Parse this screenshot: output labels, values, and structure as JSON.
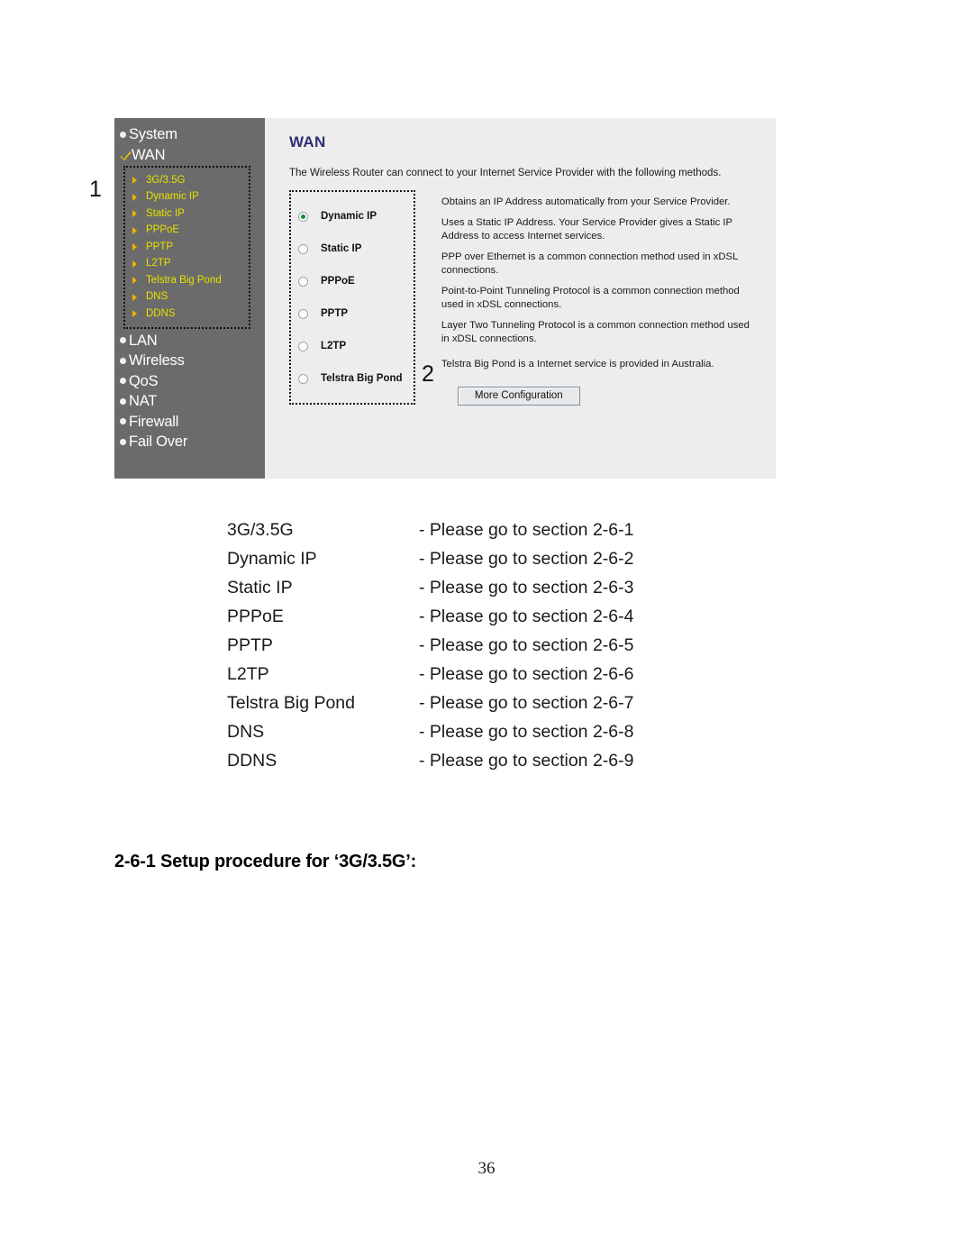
{
  "screenshot": {
    "sidebar": {
      "top_items": [
        {
          "label": "System",
          "icon": "bullet-icon",
          "selected": false
        },
        {
          "label": "WAN",
          "icon": "check-icon",
          "selected": true
        }
      ],
      "submenu": [
        {
          "label": "3G/3.5G"
        },
        {
          "label": "Dynamic IP"
        },
        {
          "label": "Static IP"
        },
        {
          "label": "PPPoE"
        },
        {
          "label": "PPTP"
        },
        {
          "label": "L2TP"
        },
        {
          "label": "Telstra Big Pond"
        },
        {
          "label": "DNS"
        },
        {
          "label": "DDNS"
        }
      ],
      "bottom_items": [
        {
          "label": "LAN"
        },
        {
          "label": "Wireless"
        },
        {
          "label": "QoS"
        },
        {
          "label": "NAT"
        },
        {
          "label": "Firewall"
        },
        {
          "label": "Fail Over"
        }
      ]
    },
    "main": {
      "title": "WAN",
      "intro": "The Wireless Router can connect to your Internet Service Provider with the following methods.",
      "methods": [
        {
          "label": "Dynamic IP",
          "selected": true,
          "description": "Obtains an IP Address automatically from your Service Provider."
        },
        {
          "label": "Static IP",
          "selected": false,
          "description": "Uses a Static IP Address. Your Service Provider gives a Static IP Address to access Internet services."
        },
        {
          "label": "PPPoE",
          "selected": false,
          "description": "PPP over Ethernet is a common connection method used in xDSL connections."
        },
        {
          "label": "PPTP",
          "selected": false,
          "description": "Point-to-Point Tunneling Protocol is a common connection method used in xDSL connections."
        },
        {
          "label": "L2TP",
          "selected": false,
          "description": "Layer Two Tunneling Protocol is a common connection method used in xDSL connections."
        },
        {
          "label": "Telstra Big Pond",
          "selected": false,
          "description": "Telstra Big Pond is a Internet service is provided in Australia."
        }
      ],
      "more_button": "More Configuration"
    },
    "callouts": {
      "one": "1",
      "two": "2"
    },
    "colors": {
      "sidebar_bg": "#6b6b6b",
      "panel_bg": "#ededed",
      "title_blue": "#2b2f75",
      "submenu_yellow": "#e8e000",
      "radio_green": "#1a8a2e"
    }
  },
  "reference_list": [
    {
      "name": "3G/3.5G",
      "link": "- Please go to section 2-6-1"
    },
    {
      "name": "Dynamic IP",
      "link": "- Please go to section 2-6-2"
    },
    {
      "name": "Static IP",
      "link": "- Please go to section 2-6-3"
    },
    {
      "name": "PPPoE",
      "link": "- Please go to section 2-6-4"
    },
    {
      "name": "PPTP",
      "link": "- Please go to section 2-6-5"
    },
    {
      "name": "L2TP",
      "link": "- Please go to section 2-6-6"
    },
    {
      "name": "Telstra Big Pond",
      "link": "- Please go to section 2-6-7"
    },
    {
      "name": "DNS",
      "link": "- Please go to section 2-6-8"
    },
    {
      "name": "DDNS",
      "link": "- Please go to section 2-6-9"
    }
  ],
  "section_heading": "2-6-1 Setup procedure for ‘3G/3.5G’:",
  "page_number": "36"
}
